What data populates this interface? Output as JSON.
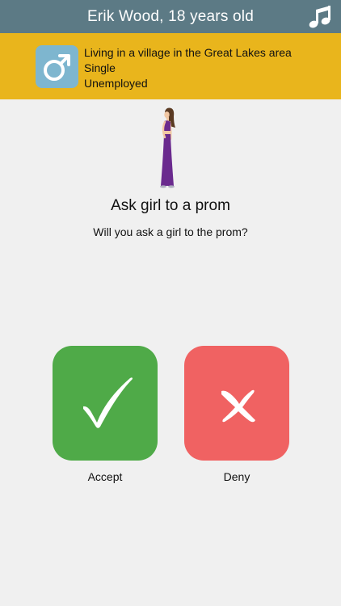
{
  "header": {
    "title": "Erik Wood, 18 years old",
    "music_icon": "music-note-icon"
  },
  "profile": {
    "gender_icon": "male-symbol-icon",
    "location": "Living in a village in the Great Lakes area",
    "relationship": "Single",
    "employment": "Unemployed"
  },
  "event": {
    "illustration": "girl-in-purple-dress",
    "title": "Ask girl to a prom",
    "question": "Will you ask a girl to the prom?"
  },
  "choices": {
    "accept_label": "Accept",
    "deny_label": "Deny",
    "accept_icon": "checkmark-icon",
    "deny_icon": "cross-icon"
  },
  "colors": {
    "header_bg": "#5c7a85",
    "info_bar_bg": "#e9b51c",
    "gender_badge_bg": "#7eb6cf",
    "accept_bg": "#4faa48",
    "deny_bg": "#f06262",
    "page_bg": "#f0f0f0",
    "dress": "#6a2a8e"
  }
}
